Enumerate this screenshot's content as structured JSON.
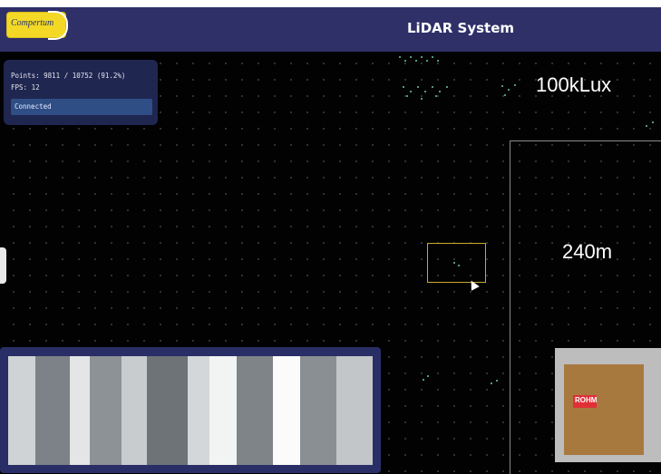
{
  "header": {
    "logo_text": "Compertum",
    "title": "LiDAR System"
  },
  "stats_panel": {
    "points_line": "Points: 9811 / 10752 (91.2%)",
    "fps_line": "FPS: 12",
    "status": "Connected"
  },
  "overlay": {
    "illuminance": "100kLux",
    "range": "240m"
  },
  "box_photo": {
    "label_text": "ROHM"
  },
  "colors": {
    "header_bg": "#2f3068",
    "panel_bg": "#1f2650",
    "status_bg": "#2f4e85",
    "roi_border": "#c7a92f",
    "logo_bg": "#f4d826",
    "point_color": "#6fc7a9"
  }
}
